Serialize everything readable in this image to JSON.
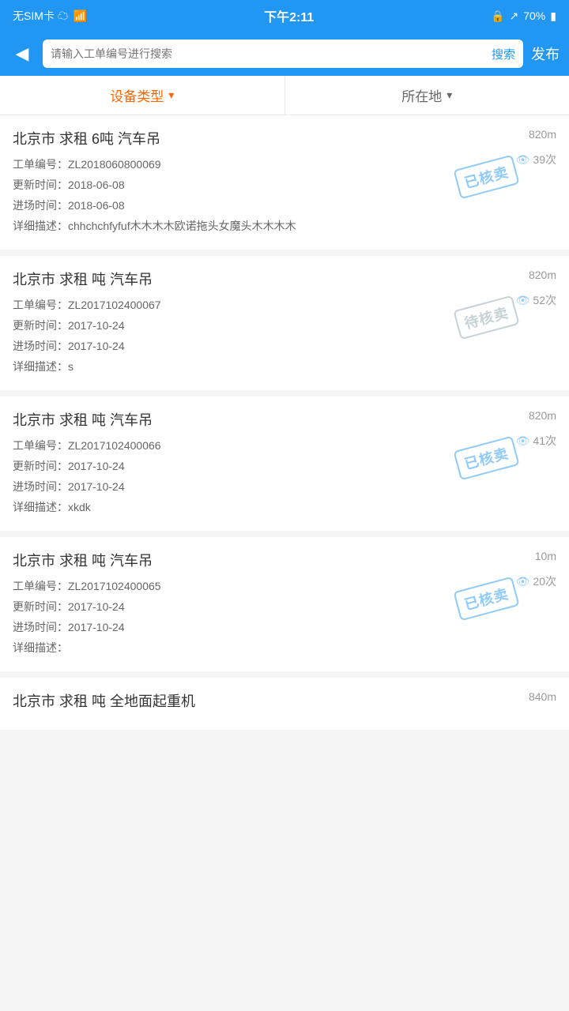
{
  "status_bar": {
    "left": "无SIM卡 ☁",
    "center": "下午2:11",
    "right": "70%"
  },
  "header": {
    "back_icon": "◀",
    "search_placeholder": "请输入工单编号进行搜索",
    "search_label": "搜索",
    "publish_label": "发布"
  },
  "filters": [
    {
      "label": "设备类型",
      "active": true
    },
    {
      "label": "所在地",
      "active": false
    }
  ],
  "items": [
    {
      "title": "北京市 求租 6吨 汽车吊",
      "distance": "820m",
      "order_no": "工单编号：ZL2018060800069",
      "views": "39次",
      "update_time": "更新时间：2018-06-08",
      "entry_time": "进场时间：2018-06-08",
      "description": "详细描述：chhchchfyfuf木木木木欧诺拖头女魔头木木木木",
      "stamp": "已核卖",
      "stamp_type": "sold",
      "views_row": 2
    },
    {
      "title": "北京市 求租 吨 汽车吊",
      "distance": "820m",
      "order_no": "工单编号：ZL2017102400067",
      "views": "52次",
      "update_time": "更新时间：2017-10-24",
      "entry_time": "进场时间：2017-10-24",
      "description": "详细描述：s",
      "stamp": "待核卖",
      "stamp_type": "pending",
      "views_row": 2
    },
    {
      "title": "北京市 求租 吨 汽车吊",
      "distance": "820m",
      "order_no": "工单编号：ZL2017102400066",
      "views": "41次",
      "update_time": "更新时间：2017-10-24",
      "entry_time": "进场时间：2017-10-24",
      "description": "详细描述：xkdk",
      "stamp": "已核卖",
      "stamp_type": "sold",
      "views_row": 2
    },
    {
      "title": "北京市 求租 吨 汽车吊",
      "distance": "10m",
      "order_no": "工单编号：ZL2017102400065",
      "views": "20次",
      "update_time": "更新时间：2017-10-24",
      "entry_time": "进场时间：2017-10-24",
      "description": "详细描述：",
      "stamp": "已核卖",
      "stamp_type": "sold",
      "views_row": 2
    },
    {
      "title": "北京市 求租 吨 全地面起重机",
      "distance": "840m",
      "order_no": "",
      "views": "",
      "update_time": "",
      "entry_time": "",
      "description": "",
      "stamp": "",
      "stamp_type": "none",
      "views_row": 0,
      "partial": true
    }
  ]
}
